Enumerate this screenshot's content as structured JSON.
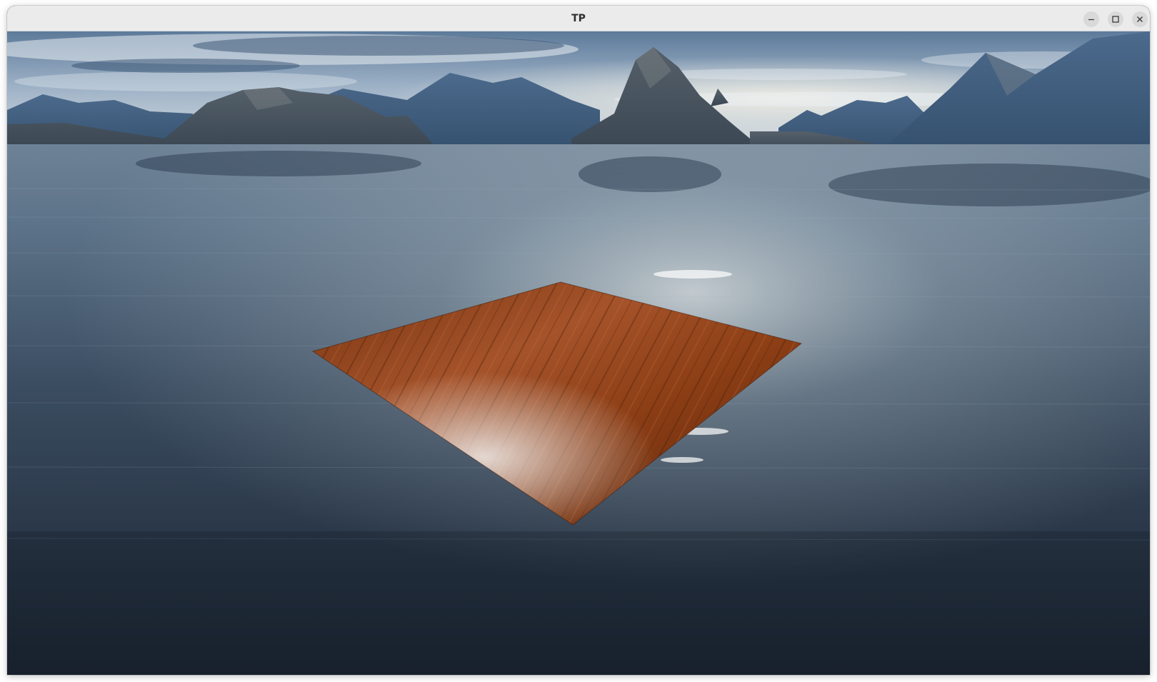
{
  "window": {
    "title": "TP"
  },
  "controls": {
    "minimize_icon": "minimize-icon",
    "maximize_icon": "maximize-icon",
    "close_icon": "close-icon"
  },
  "scene": {
    "sky_colors": [
      "#5d7a9a",
      "#9db1c6",
      "#d9dfe2"
    ],
    "water_colors": [
      "#33445a",
      "#5d7389",
      "#202b3a"
    ],
    "plank_colors": [
      "#6e2f10",
      "#a5532a",
      "#4f2009"
    ]
  }
}
